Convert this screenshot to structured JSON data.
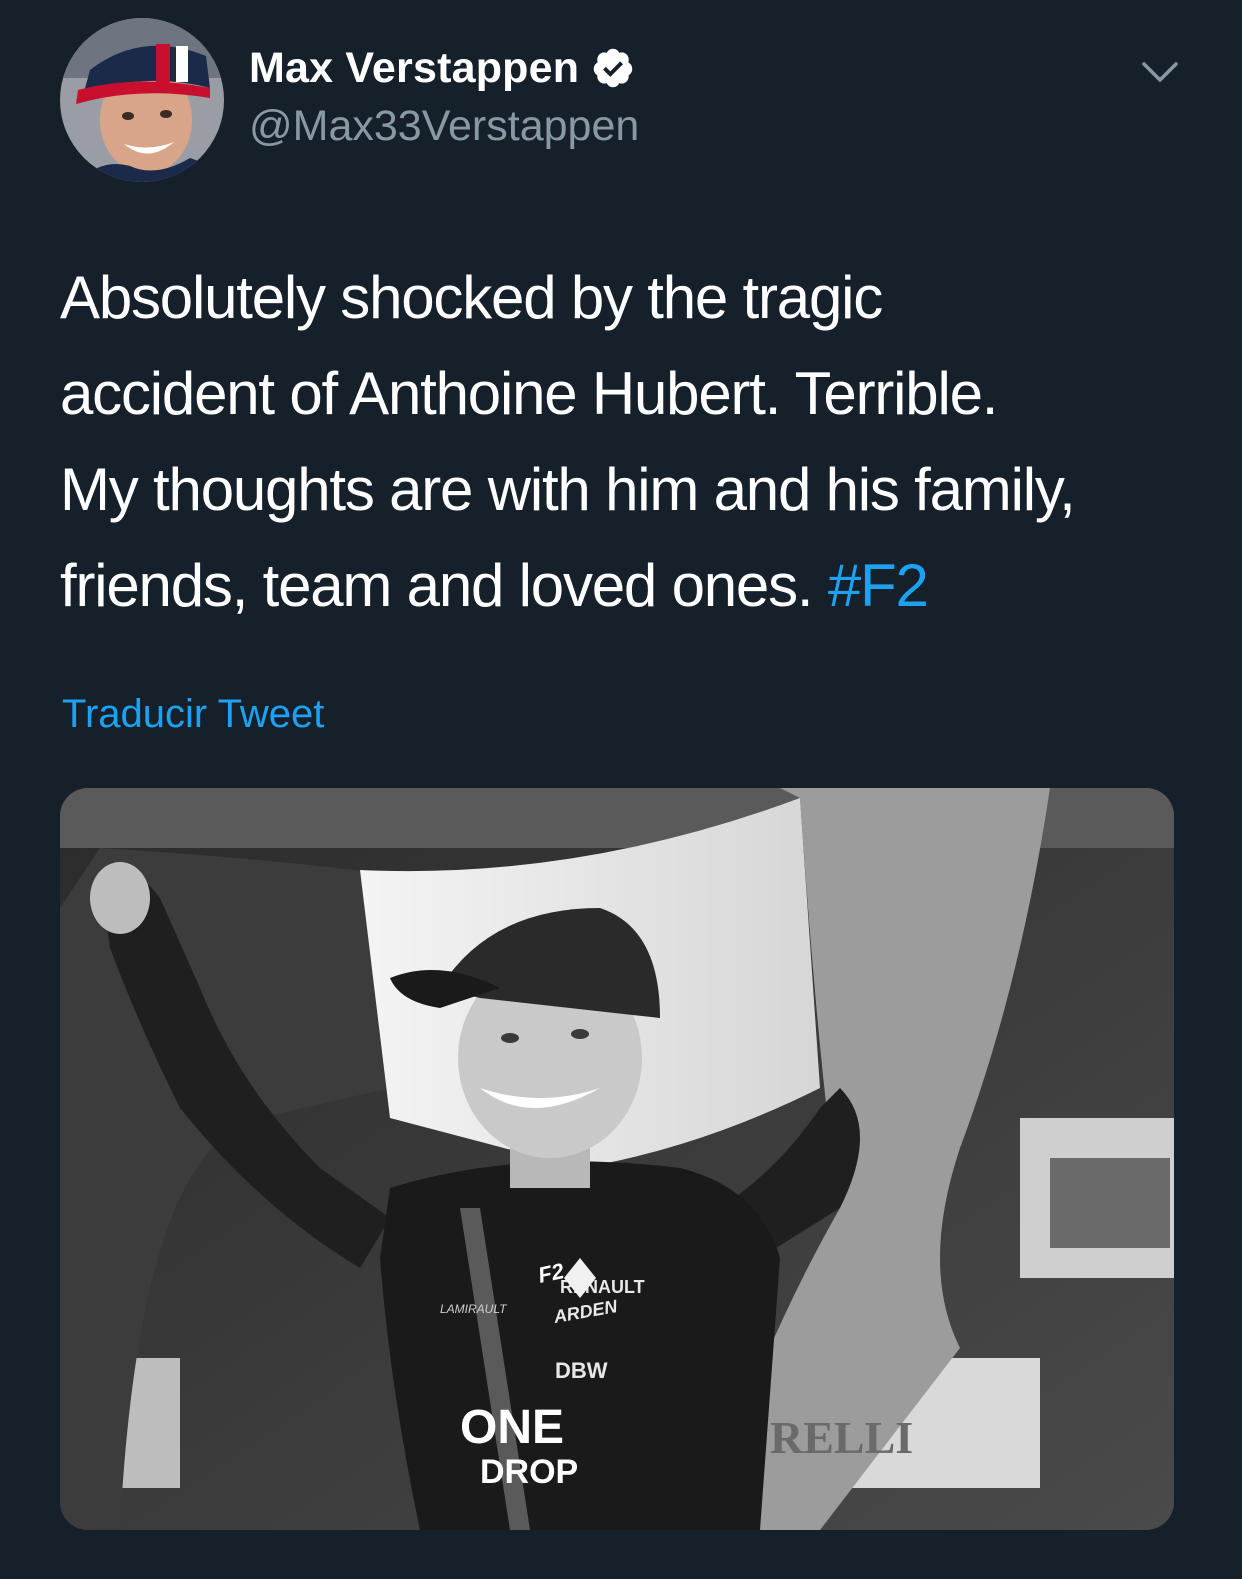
{
  "user": {
    "display_name": "Max Verstappen",
    "handle": "@Max33Verstappen",
    "verified": true,
    "avatar_icon": "profile-photo"
  },
  "tweet": {
    "text_lines": [
      "Absolutely shocked by the tragic",
      "accident of Anthoine Hubert. Terrible.",
      "My thoughts are with him and his family,",
      "friends, team and loved ones. "
    ],
    "hashtag": "#F2",
    "translate_label": "Traducir Tweet"
  },
  "media": {
    "type": "photo",
    "style": "black-and-white",
    "description_icon": "photo-image",
    "visible_texts": {
      "renault": "RENAULT",
      "arden": "ARDEN",
      "dbw": "DBW",
      "one": "ONE",
      "drop": "DROP",
      "lamirault": "LAMIRAULT",
      "f2": "F2",
      "relli": "RELLI"
    }
  },
  "colors": {
    "background": "#15202b",
    "text": "#ffffff",
    "secondary": "#8899a6",
    "link": "#1da1f2"
  }
}
